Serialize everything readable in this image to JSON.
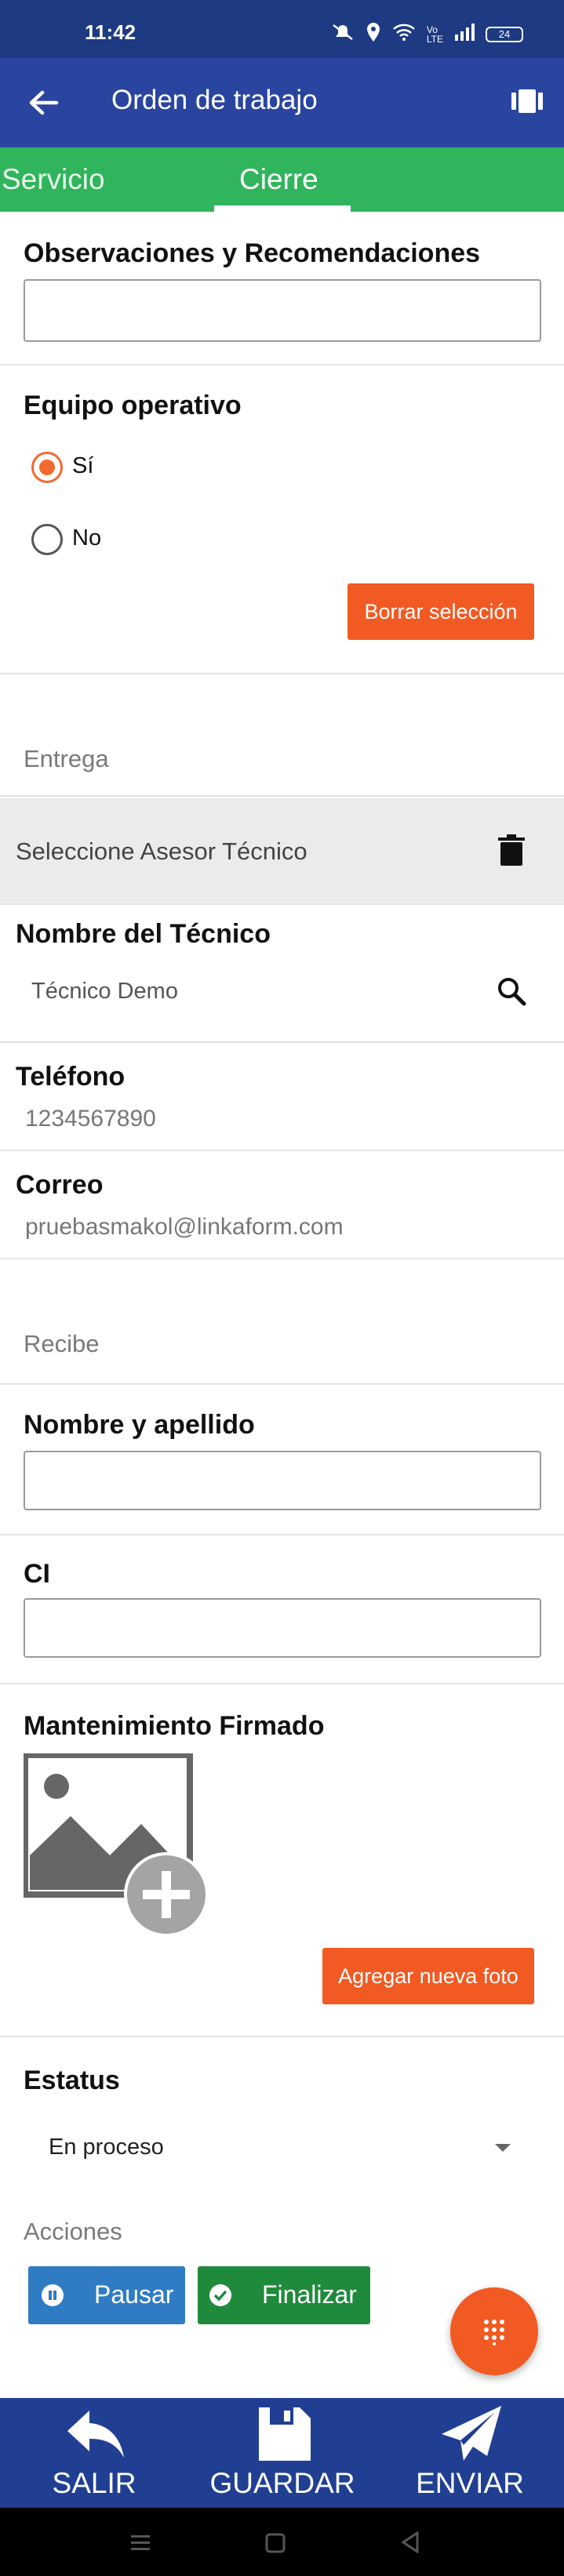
{
  "status_bar": {
    "time": "11:42",
    "battery": "24"
  },
  "app_bar": {
    "title": "Orden de trabajo"
  },
  "tabs": [
    {
      "label": "Servicio",
      "active": false
    },
    {
      "label": "Cierre",
      "active": true
    }
  ],
  "observaciones": {
    "label": "Observaciones y Recomendaciones",
    "value": ""
  },
  "equipo_operativo": {
    "label": "Equipo operativo",
    "options": [
      "Sí",
      "No"
    ],
    "selected": "Sí",
    "clear_button": "Borrar selección"
  },
  "entrega": {
    "heading": "Entrega",
    "asesor_placeholder": "Seleccione Asesor Técnico",
    "tecnico_label": "Nombre del Técnico",
    "tecnico_value": "Técnico Demo",
    "telefono_label": "Teléfono",
    "telefono_value": "1234567890",
    "correo_label": "Correo",
    "correo_value": "pruebasmakol@linkaform.com"
  },
  "recibe": {
    "heading": "Recibe",
    "nombre_label": "Nombre y apellido",
    "nombre_value": "",
    "ci_label": "CI",
    "ci_value": ""
  },
  "mantenimiento": {
    "label": "Mantenimiento Firmado",
    "add_photo_button": "Agregar nueva foto"
  },
  "estatus": {
    "label": "Estatus",
    "value": "En proceso"
  },
  "acciones": {
    "label": "Acciones",
    "pause_button": "Pausar",
    "finish_button": "Finalizar"
  },
  "bottom_nav": [
    {
      "label": "SALIR",
      "icon": "reply-icon"
    },
    {
      "label": "GUARDAR",
      "icon": "save-icon"
    },
    {
      "label": "ENVIAR",
      "icon": "send-icon"
    }
  ],
  "colors": {
    "app_bar": "#2a45a0",
    "tabs": "#30b45c",
    "accent_orange": "#f15a22",
    "pause_blue": "#2f7cc4",
    "finish_green": "#1f8a3b",
    "bottom_nav": "#213f92"
  }
}
